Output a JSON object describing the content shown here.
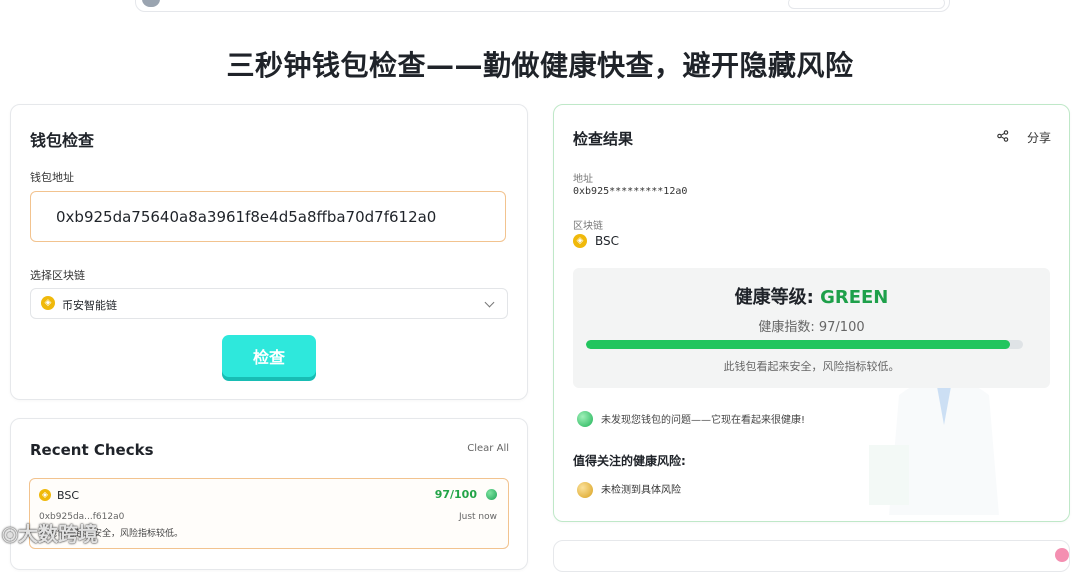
{
  "page": {
    "title": "三秒钟钱包检查——勤做健康快查，避开隐藏风险"
  },
  "wallet_check": {
    "title": "钱包检查",
    "address_label": "钱包地址",
    "address_value": "0xb925da75640a8a3961f8e4d5a8ffba70d7f612a0",
    "chain_label": "选择区块链",
    "chain_value": "币安智能链",
    "check_button": "检查"
  },
  "recent_checks": {
    "title": "Recent Checks",
    "clear_all": "Clear All",
    "items": [
      {
        "chain": "BSC",
        "score": "97/100",
        "address": "0xb925da...f612a0",
        "time": "Just now",
        "summary": "此钱包看起来安全，风险指标较低。"
      }
    ]
  },
  "result": {
    "title": "检查结果",
    "share_label": "分享",
    "address_label": "地址",
    "address_value": "0xb925*********12a0",
    "chain_label": "区块链",
    "chain_value": "BSC",
    "health_level_label": "健康等级: ",
    "health_level_value": "GREEN",
    "health_index_label": "健康指数: 97/100",
    "health_score": 97,
    "health_score_max": 100,
    "health_summary": "此钱包看起来安全，风险指标较低。",
    "no_issue_text": "未发现您钱包的问题——它现在看起来很健康!",
    "risks_title": "值得关注的健康风险:",
    "risk_items": [
      "未检测到具体风险"
    ]
  },
  "watermark": "大数跨境",
  "colors": {
    "accent_cyan": "#2ee8dc",
    "health_green": "#22c55e",
    "level_green": "#1ea04a",
    "score_green": "#22a447",
    "input_border_orange": "#f2c38f",
    "bnb_yellow": "#f0b90b",
    "result_border": "#bfe8c8"
  },
  "icons": {
    "share": "share-icon",
    "chain": "bnb-coin-icon",
    "dropdown": "chevron-down-icon"
  }
}
